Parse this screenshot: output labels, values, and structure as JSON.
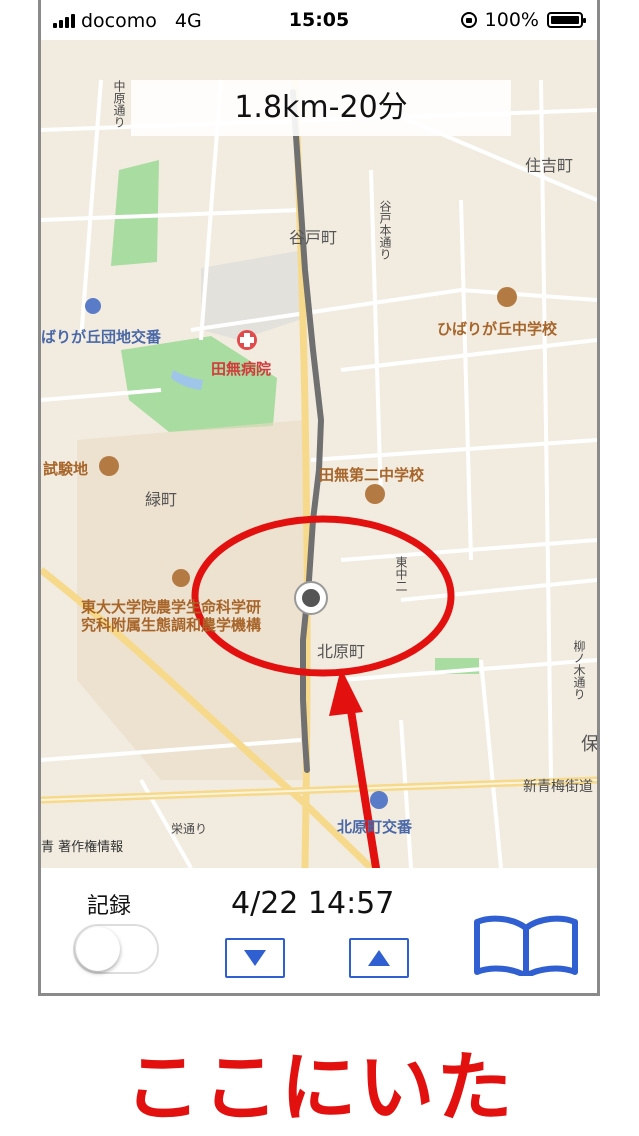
{
  "status_bar": {
    "carrier": "docomo",
    "network": "4G",
    "time": "15:05",
    "battery": "100%"
  },
  "route": {
    "distance_time": "1.8km-20分"
  },
  "map": {
    "labels": {
      "sumiyoshi": "住吉町",
      "yatocho": "谷戸町",
      "yato_hondori": "谷戸本通り",
      "hibarigaoka_police": "ばりが丘団地交番",
      "hibarigaoka_jhs": "ひばりが丘中学校",
      "tanashi_hospital": "田無病院",
      "shikenchi": "試験地",
      "midoricho": "緑町",
      "tanashi_dai2": "田無第二中学校",
      "todai_1": "東大大学院農学生命科学研",
      "todai_2": "究科附属生態調和農学機構",
      "kitaharacho": "北原町",
      "higashi_naka": "東中二",
      "shin_ome": "新青梅街道",
      "kitahara_police": "北原町交番",
      "sakae_dori": "栄通り",
      "nakahara_dori": "中原通り",
      "yamaki_dori": "柳ノ木通り",
      "ho": "保"
    },
    "copyright": "著作権情報",
    "copyright_prefix": "青"
  },
  "controls": {
    "record_label": "記録",
    "record_on": false,
    "datetime": "4/22 14:57",
    "down_icon": "triangle-down-icon",
    "up_icon": "triangle-up-icon",
    "book_icon": "open-book-icon"
  },
  "annotation": {
    "caption": "ここにいた"
  },
  "colors": {
    "annotation_red": "#e2110f",
    "button_blue": "#2f5fd0",
    "route_gray": "#707070"
  }
}
